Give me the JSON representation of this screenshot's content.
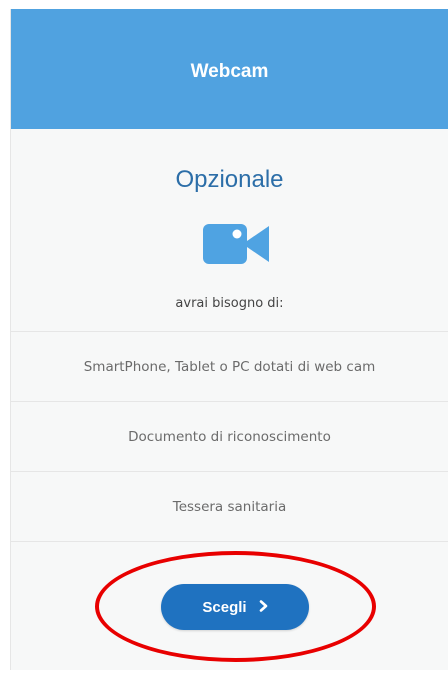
{
  "card": {
    "header_title": "Webcam",
    "subtitle": "Opzionale",
    "icon": "video-camera-icon",
    "needs_label": "avrai bisogno di:",
    "requirements": [
      "SmartPhone, Tablet o PC dotati di web cam",
      "Documento di riconoscimento",
      "Tessera sanitaria"
    ],
    "button_label": "Scegli",
    "button_icon": "chevron-right-icon"
  },
  "colors": {
    "header_bg": "#50a2e0",
    "subtitle": "#2c6ea8",
    "icon": "#4fa3e2",
    "button_bg": "#1f72c0",
    "highlight": "#e80000"
  }
}
